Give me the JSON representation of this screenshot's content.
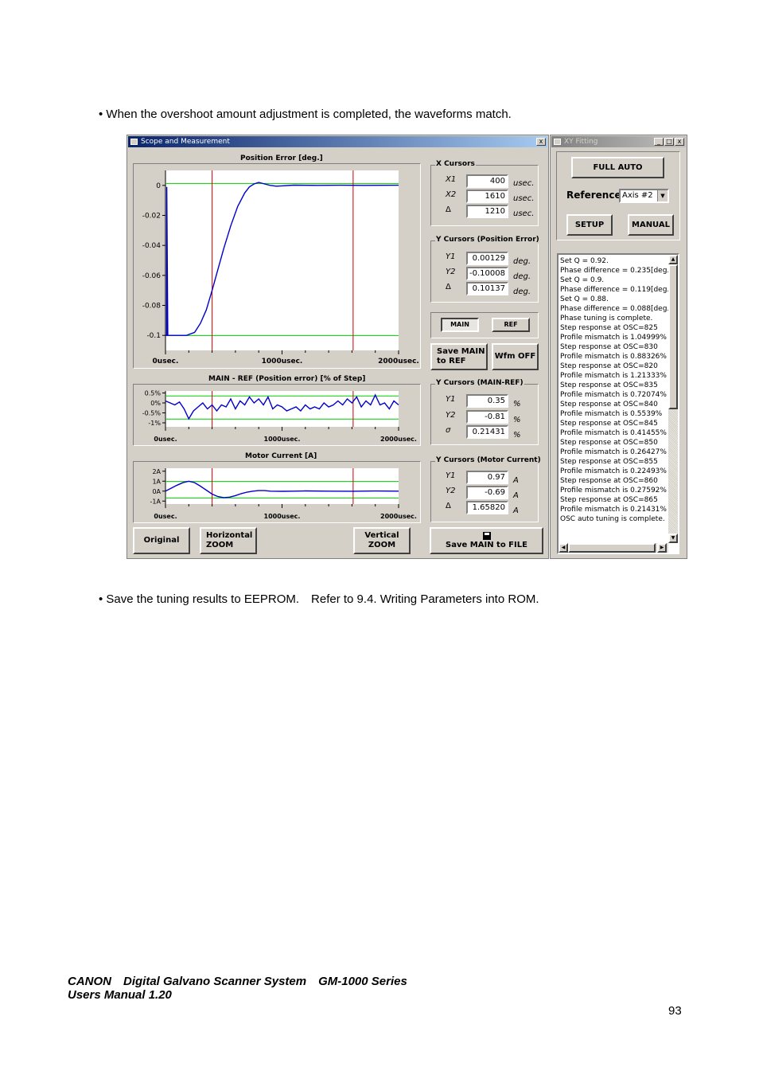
{
  "intro_text": "When the overshoot amount adjustment is completed, the waveforms match.",
  "save_text": "Save the tuning results to EEPROM.　Refer to 9.4. Writing Parameters into ROM.",
  "scope_window": {
    "title": "Scope and Measurement",
    "close_glyph": "x",
    "charts": {
      "position_error_title": "Position Error [deg.]",
      "main_ref_title": "MAIN - REF (Position error) [% of Step]",
      "motor_current_title": "Motor Current [A]"
    },
    "x_cursors": {
      "title": "X Cursors",
      "x1_label": "X1",
      "x1_value": "400",
      "x1_unit": "usec.",
      "x2_label": "X2",
      "x2_value": "1610",
      "x2_unit": "usec.",
      "d_label": "Δ",
      "d_value": "1210",
      "d_unit": "usec."
    },
    "y_pos": {
      "title": "Y Cursors (Position Error)",
      "y1_label": "Y1",
      "y1_value": "0.00129",
      "y1_unit": "deg.",
      "y2_label": "Y2",
      "y2_value": "-0.10008",
      "y2_unit": "deg.",
      "d_label": "Δ",
      "d_value": "0.10137",
      "d_unit": "deg."
    },
    "main_button": "MAIN",
    "ref_button": "REF",
    "save_main_ref": "Save MAIN to REF",
    "wfm_off": "Wfm OFF",
    "y_mainref": {
      "title": "Y Cursors (MAIN-REF)",
      "y1_label": "Y1",
      "y1_value": "0.35",
      "y1_unit": "%",
      "y2_label": "Y2",
      "y2_value": "-0.81",
      "y2_unit": "%",
      "s_label": "σ",
      "s_value": "0.21431",
      "s_unit": "%"
    },
    "y_motor": {
      "title": "Y Cursors (Motor Current)",
      "y1_label": "Y1",
      "y1_value": "0.97",
      "y1_unit": "A",
      "y2_label": "Y2",
      "y2_value": "-0.69",
      "y2_unit": "A",
      "d_label": "Δ",
      "d_value": "1.65820",
      "d_unit": "A"
    },
    "original_button": "Original",
    "horizontal_zoom": "Horizontal ZOOM",
    "vertical_zoom": "Vertical ZOOM",
    "save_file": "Save MAIN to FILE"
  },
  "xy_window": {
    "title": "XY Fitting",
    "full_auto": "FULL AUTO",
    "reference_label": "Reference",
    "reference_value": "Axis #2",
    "setup": "SETUP",
    "manual": "MANUAL",
    "log_lines": [
      "Set Q = 0.92.",
      "Phase difference = 0.235[deg.]",
      "Set Q = 0.9.",
      "Phase difference = 0.119[deg.]",
      "Set Q = 0.88.",
      "Phase difference = 0.088[deg.]",
      "Phase tuning is complete.",
      "Step response at OSC=825",
      "Profile mismatch is 1.04999%",
      "Step response at OSC=830",
      "Profile mismatch is 0.88326%",
      "Step response at OSC=820",
      "Profile mismatch is 1.21333%",
      "Step response at OSC=835",
      "Profile mismatch is 0.72074%",
      "Step response at OSC=840",
      "Profile mismatch is 0.5539%",
      "Step response at OSC=845",
      "Profile mismatch is 0.41455%",
      "Step response at OSC=850",
      "Profile mismatch is 0.26427%",
      "Step response at OSC=855",
      "Profile mismatch is 0.22493%",
      "Step response at OSC=860",
      "Profile mismatch is 0.27592%",
      "Step response at OSC=865",
      "Profile mismatch is 0.21431%",
      "OSC auto tuning is complete."
    ]
  },
  "footer_line1": "CANON　Digital Galvano Scanner System　GM-1000 Series",
  "footer_line2": "Users Manual 1.20",
  "page_number": "93",
  "colors": {
    "trace": "#0000cc",
    "cursor_x": "#cc0000",
    "cursor_y": "#00cc00",
    "title_active": "#0a246a"
  },
  "chart_data": [
    {
      "type": "line",
      "title": "Position Error [deg.]",
      "xlim": [
        0,
        2000
      ],
      "ylim": [
        -0.11,
        0.01
      ],
      "x_ticks": [
        "0usec.",
        "1000usec.",
        "2000usec."
      ],
      "y_ticks": [
        {
          "label": "0",
          "v": 0
        },
        {
          "label": "-0.02",
          "v": -0.02
        },
        {
          "label": "-0.04",
          "v": -0.04
        },
        {
          "label": "-0.06",
          "v": -0.06
        },
        {
          "label": "-0.08",
          "v": -0.08
        },
        {
          "label": "-0.1",
          "v": -0.1
        }
      ],
      "cursor_x": [
        400,
        1610
      ],
      "cursor_y": [
        0.00129,
        -0.10008
      ],
      "x": [
        0,
        10,
        11,
        20,
        100,
        180,
        250,
        300,
        350,
        400,
        450,
        500,
        560,
        620,
        680,
        720,
        760,
        800,
        850,
        900,
        950,
        1000,
        1100,
        1300,
        1500,
        1700,
        2000
      ],
      "y": [
        -0.1,
        -0.1,
        -0.001,
        -0.1,
        -0.1,
        -0.1,
        -0.098,
        -0.092,
        -0.083,
        -0.07,
        -0.056,
        -0.042,
        -0.027,
        -0.014,
        -0.005,
        -0.001,
        0.001,
        0.002,
        0.001,
        0.0,
        -0.0005,
        -0.0003,
        0.0002,
        0.0,
        0.0001,
        0.0,
        0.0001
      ]
    },
    {
      "type": "line",
      "title": "MAIN - REF (Position error) [% of Step]",
      "xlim": [
        0,
        2000
      ],
      "ylim": [
        -1.2,
        0.6
      ],
      "x_ticks": [
        "0usec.",
        "1000usec.",
        "2000usec."
      ],
      "y_ticks": [
        {
          "label": "0.5%",
          "v": 0.5
        },
        {
          "label": "0%",
          "v": 0
        },
        {
          "label": "-0.5%",
          "v": -0.5
        },
        {
          "label": "-1%",
          "v": -1
        }
      ],
      "cursor_x": [
        400,
        1610
      ],
      "cursor_y": [
        0.35,
        -0.81
      ],
      "x": [
        0,
        40,
        80,
        120,
        160,
        200,
        240,
        280,
        320,
        360,
        400,
        440,
        480,
        520,
        560,
        600,
        640,
        680,
        720,
        760,
        800,
        840,
        880,
        920,
        960,
        1000,
        1040,
        1080,
        1120,
        1160,
        1200,
        1240,
        1280,
        1320,
        1360,
        1400,
        1440,
        1480,
        1520,
        1560,
        1600,
        1640,
        1680,
        1720,
        1760,
        1800,
        1840,
        1880,
        1920,
        1960,
        2000
      ],
      "y": [
        0.1,
        0.0,
        -0.1,
        0.05,
        -0.3,
        -0.8,
        -0.4,
        -0.2,
        0.0,
        -0.3,
        -0.1,
        -0.4,
        -0.1,
        -0.2,
        0.2,
        -0.3,
        0.1,
        -0.1,
        0.3,
        0.0,
        0.2,
        -0.1,
        0.3,
        -0.3,
        -0.1,
        -0.2,
        -0.4,
        -0.3,
        -0.2,
        -0.4,
        -0.1,
        -0.3,
        -0.2,
        -0.3,
        0.0,
        -0.2,
        -0.1,
        0.1,
        -0.1,
        0.2,
        0.0,
        0.3,
        -0.2,
        0.1,
        -0.1,
        0.4,
        -0.1,
        0.0,
        -0.3,
        0.1,
        -0.1
      ]
    },
    {
      "type": "line",
      "title": "Motor Current [A]",
      "xlim": [
        0,
        2000
      ],
      "ylim": [
        -1.3,
        2.3
      ],
      "x_ticks": [
        "0usec.",
        "1000usec.",
        "2000usec."
      ],
      "y_ticks": [
        {
          "label": "2A",
          "v": 2
        },
        {
          "label": "1A",
          "v": 1
        },
        {
          "label": "0A",
          "v": 0
        },
        {
          "label": "-1A",
          "v": -1
        }
      ],
      "cursor_x": [
        400,
        1610
      ],
      "cursor_y": [
        0.97,
        -0.69
      ],
      "x": [
        0,
        50,
        100,
        150,
        200,
        250,
        300,
        350,
        400,
        450,
        500,
        550,
        600,
        650,
        700,
        750,
        800,
        850,
        900,
        1000,
        1100,
        1200,
        1400,
        1600,
        1800,
        2000
      ],
      "y": [
        0.0,
        0.3,
        0.6,
        0.85,
        1.0,
        0.85,
        0.5,
        0.1,
        -0.3,
        -0.55,
        -0.65,
        -0.6,
        -0.45,
        -0.25,
        -0.1,
        0.0,
        0.05,
        0.05,
        0.0,
        -0.02,
        0.0,
        0.02,
        0.0,
        -0.01,
        0.01,
        0.0
      ]
    }
  ]
}
